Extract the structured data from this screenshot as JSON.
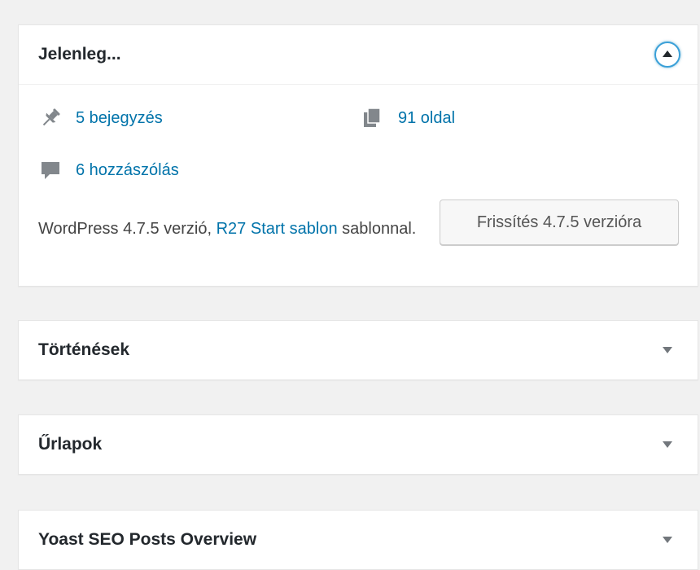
{
  "widgets": {
    "at_a_glance": {
      "title": "Jelenleg...",
      "posts": "5 bejegyzés",
      "pages": "91 oldal",
      "comments": "6 hozzászólás",
      "version_prefix": "WordPress 4.7.5 verzió, ",
      "theme_link": "R27 Start sablon",
      "version_suffix": " sablonnal.",
      "update_button": "Frissítés 4.7.5 verzióra",
      "toggle_icon": "arrow-up-icon"
    },
    "activity": {
      "title": "Történések",
      "toggle_icon": "arrow-down-icon"
    },
    "forms": {
      "title": "Űrlapok",
      "toggle_icon": "arrow-down-icon"
    },
    "yoast": {
      "title": "Yoast SEO Posts Overview",
      "toggle_icon": "arrow-down-icon"
    }
  },
  "colors": {
    "link": "#0073aa",
    "background": "#f1f1f1",
    "panel": "#ffffff",
    "focus_ring": "#3aa0d8"
  }
}
